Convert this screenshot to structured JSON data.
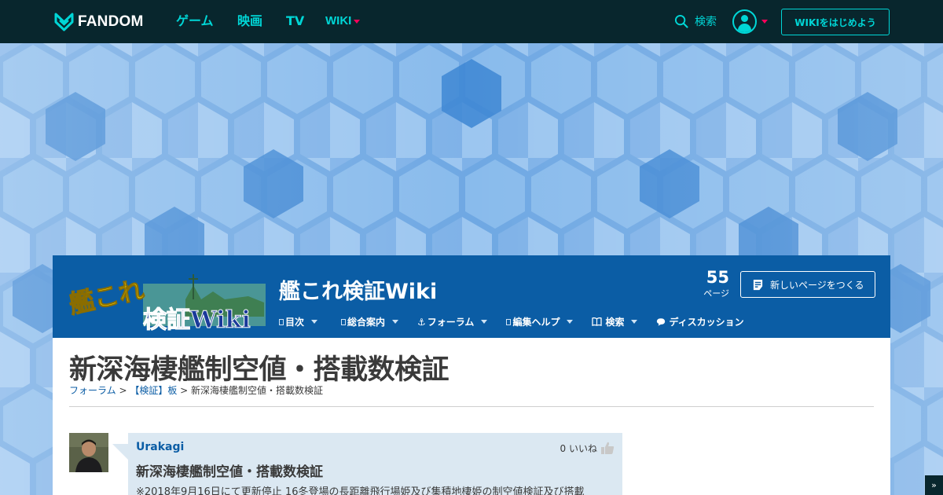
{
  "global_nav": {
    "brand": "FANDOM",
    "links": [
      "ゲーム",
      "映画",
      "TV"
    ],
    "wiki_link": "WIKI",
    "search_label": "検索",
    "start_wiki_label": "WIKIをはじめよう",
    "colors": {
      "bg": "#08262d",
      "accent": "#00d6d6",
      "caret": "#fa005a"
    }
  },
  "community": {
    "wordmark_text_top": "艦これ",
    "wordmark_text_bottom": "検証Wiki",
    "name": "艦これ検証Wiki",
    "page_count": "55",
    "page_count_label": "ページ",
    "new_page_label": "新しいページをつくる",
    "nav": [
      {
        "label": "目次",
        "icon": "square-icon"
      },
      {
        "label": "総合案内",
        "icon": "square-icon"
      },
      {
        "label": "フォーラム",
        "icon": "anchor-icon"
      },
      {
        "label": "編集ヘルプ",
        "icon": "square-icon"
      },
      {
        "label": "検索",
        "icon": "book-icon"
      },
      {
        "label": "ディスカッション",
        "icon": "speech-bubble-icon"
      }
    ],
    "colors": {
      "header_bg": "#0b5da5"
    }
  },
  "article": {
    "title": "新深海棲艦制空値・搭載数検証",
    "breadcrumb": {
      "forum": "フォーラム",
      "sep1": " > ",
      "board": "【検証】板",
      "sep2": " > ",
      "current": "新深海棲艦制空値・搭載数検証"
    }
  },
  "post": {
    "author": "Urakagi",
    "likes": "0 いいね",
    "title": "新深海棲艦制空値・搭載数検証",
    "body": "※2018年9月16日にて更新停止 16冬登場の長距離飛行場姫及び集積地棲姫の制空値検証及び搭載"
  },
  "back_to_top": "»"
}
